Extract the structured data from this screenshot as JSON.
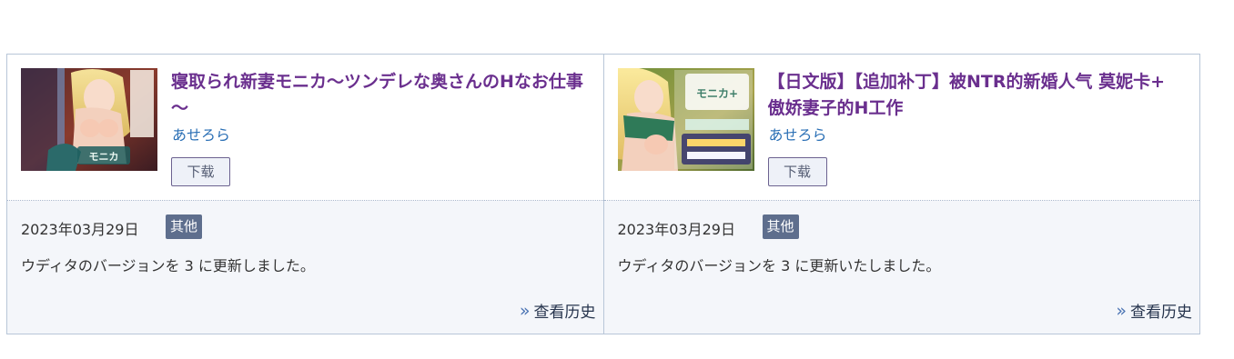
{
  "cards": [
    {
      "title": "寝取られ新妻モニカ～ツンデレな奥さんのHなお仕事～",
      "author": "あせろら",
      "download_label": "下载",
      "date": "2023年03月29日",
      "tag": "其他",
      "description": "ウディタのバージョンを 3 に更新しました。",
      "history_label": "查看历史",
      "thumbnail_text": "モニカ"
    },
    {
      "title": "【日文版】【追加补丁】被NTR的新婚人气 莫妮卡+ 傲娇妻子的H工作",
      "author": "あせろら",
      "download_label": "下载",
      "date": "2023年03月29日",
      "tag": "其他",
      "description": "ウディタのバージョンを 3 に更新いたしました。",
      "history_label": "查看历史",
      "thumbnail_text": "モニカ+"
    }
  ],
  "icons": {
    "history": "double-chevron-right-icon"
  },
  "colors": {
    "title": "#6a2f8e",
    "author": "#2a6fb5",
    "tag_bg": "#5e6e8d",
    "border": "#b8c6d8",
    "bottom_bg": "#f4f6fa"
  }
}
